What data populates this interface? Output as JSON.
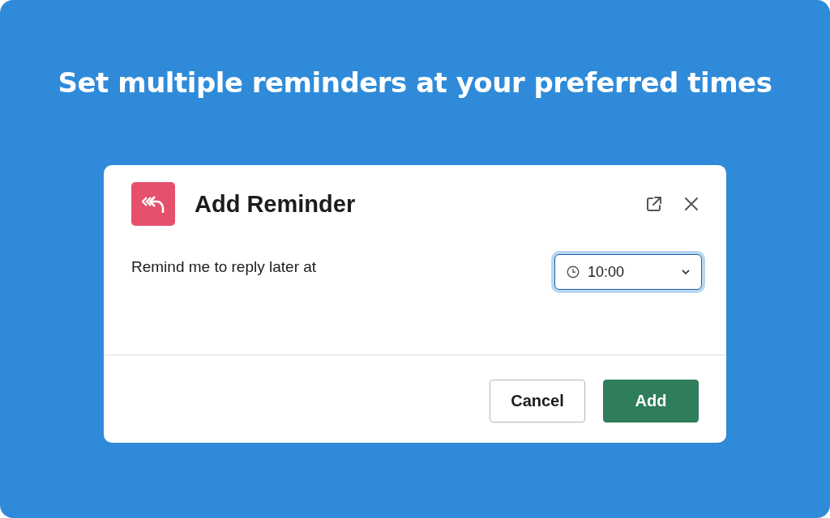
{
  "headline": "Set multiple reminders at your preferred times",
  "dialog": {
    "title": "Add Reminder",
    "label": "Remind me to reply later at",
    "time_select": {
      "value": "10:00",
      "focused": true
    },
    "buttons": [
      {
        "label": "Cancel",
        "kind": "secondary"
      },
      {
        "label": "Add",
        "kind": "primary"
      }
    ]
  }
}
